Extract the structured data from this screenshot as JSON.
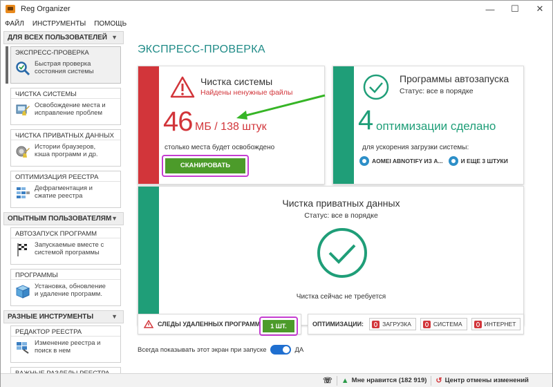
{
  "window": {
    "title": "Reg Organizer"
  },
  "menu": [
    "ФАЙЛ",
    "ИНСТРУМЕНТЫ",
    "ПОМОЩЬ"
  ],
  "sidebar": {
    "sections": [
      {
        "label": "ДЛЯ ВСЕХ ПОЛЬЗОВАТЕЛЕЙ",
        "items": [
          {
            "title": "ЭКСПРЕСС-ПРОВЕРКА",
            "desc1": "Быстрая проверка",
            "desc2": "состояния системы",
            "icon": "magnifier-check-icon"
          },
          {
            "title": "ЧИСТКА СИСТЕМЫ",
            "desc1": "Освобождение места и",
            "desc2": "исправление проблем",
            "icon": "broom-icon"
          },
          {
            "title": "ЧИСТКА ПРИВАТНЫХ ДАННЫХ",
            "desc1": "Истории браузеров,",
            "desc2": "кэша программ и др.",
            "icon": "privacy-clean-icon"
          },
          {
            "title": "ОПТИМИЗАЦИЯ РЕЕСТРА",
            "desc1": "Дефрагментация и",
            "desc2": "сжатие реестра",
            "icon": "registry-defrag-icon"
          }
        ]
      },
      {
        "label": "ОПЫТНЫМ ПОЛЬЗОВАТЕЛЯМ",
        "items": [
          {
            "title": "АВТОЗАПУСК ПРОГРАММ",
            "desc1": "Запускаемые вместе с",
            "desc2": "системой программы",
            "icon": "flag-icon"
          },
          {
            "title": "ПРОГРАММЫ",
            "desc1": "Установка, обновление",
            "desc2": "и удаление программ.",
            "icon": "box-icon"
          }
        ]
      },
      {
        "label": "РАЗНЫЕ ИНСТРУМЕНТЫ",
        "items": [
          {
            "title": "РЕДАКТОР РЕЕСТРА",
            "desc1": "Изменение реестра и",
            "desc2": "поиск в нем",
            "icon": "registry-editor-icon"
          },
          {
            "title": "ВАЖНЫЕ РАЗДЕЛЫ РЕЕСТРА",
            "desc1": "",
            "desc2": "",
            "icon": "registry-keys-icon"
          }
        ]
      }
    ]
  },
  "main": {
    "title": "ЭКСПРЕСС-ПРОВЕРКА",
    "system_clean": {
      "title": "Чистка системы",
      "status": "Найдены ненужные файлы",
      "size_number": "46",
      "size_rest": "МБ / 138 штук",
      "note": "столько места будет освобождено",
      "button": "СКАНИРОВАТЬ"
    },
    "autorun": {
      "title": "Программы автозапуска",
      "status": "Статус: все в порядке",
      "count": "4",
      "count_rest": "оптимизации сделано",
      "note": "для ускорения загрузки системы:",
      "app1": "AOMEI ABNOTIFY ИЗ A...",
      "app2": "И ЕЩЕ 3 ШТУКИ"
    },
    "private": {
      "title": "Чистка приватных данных",
      "status": "Статус: все в порядке",
      "note": "Чистка сейчас не требуется"
    },
    "traces": {
      "label": "СЛЕДЫ УДАЛЕННЫХ ПРОГРАММ",
      "button": "1 ШТ."
    },
    "optimizations": {
      "label": "ОПТИМИЗАЦИИ:",
      "buttons": [
        "ЗАГРУЗКА",
        "СИСТЕМА",
        "ИНТЕРНЕТ"
      ]
    },
    "show_at_start": {
      "label": "Всегда показывать этот экран при запуске",
      "toggle_value": "ДА"
    }
  },
  "statusbar": {
    "like": "Мне нравится (182 919)",
    "undo_center": "Центр отмены изменений"
  },
  "colors": {
    "red": "#d2353a",
    "green": "#1f9e78",
    "button_green": "#4c9b2a",
    "highlight": "#c53dd1",
    "title_teal": "#1f8b87"
  }
}
